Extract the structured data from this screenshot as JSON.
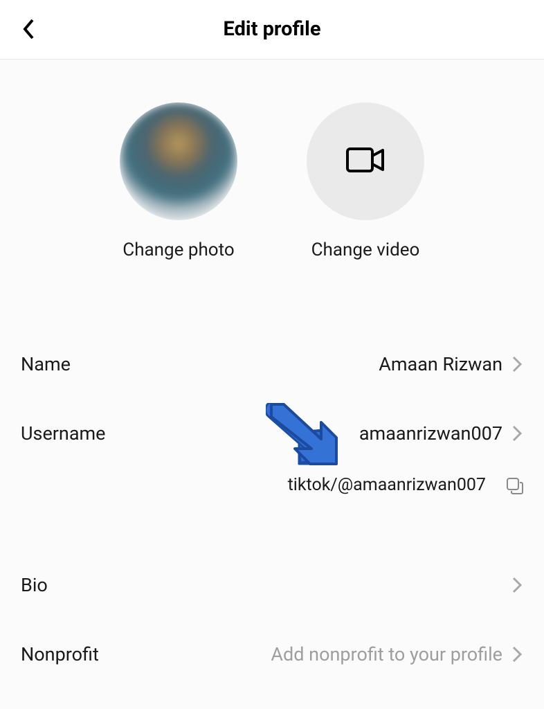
{
  "header": {
    "title": "Edit profile"
  },
  "avatars": {
    "photo_label": "Change photo",
    "video_label": "Change video"
  },
  "rows": {
    "name": {
      "label": "Name",
      "value": "Amaan Rizwan"
    },
    "username": {
      "label": "Username",
      "value": "amaanrizwan007"
    },
    "url": {
      "value": "tiktok/@amaanrizwan007"
    },
    "bio": {
      "label": "Bio",
      "value": ""
    },
    "nonprofit": {
      "label": "Nonprofit",
      "placeholder": "Add nonprofit to your profile"
    }
  }
}
